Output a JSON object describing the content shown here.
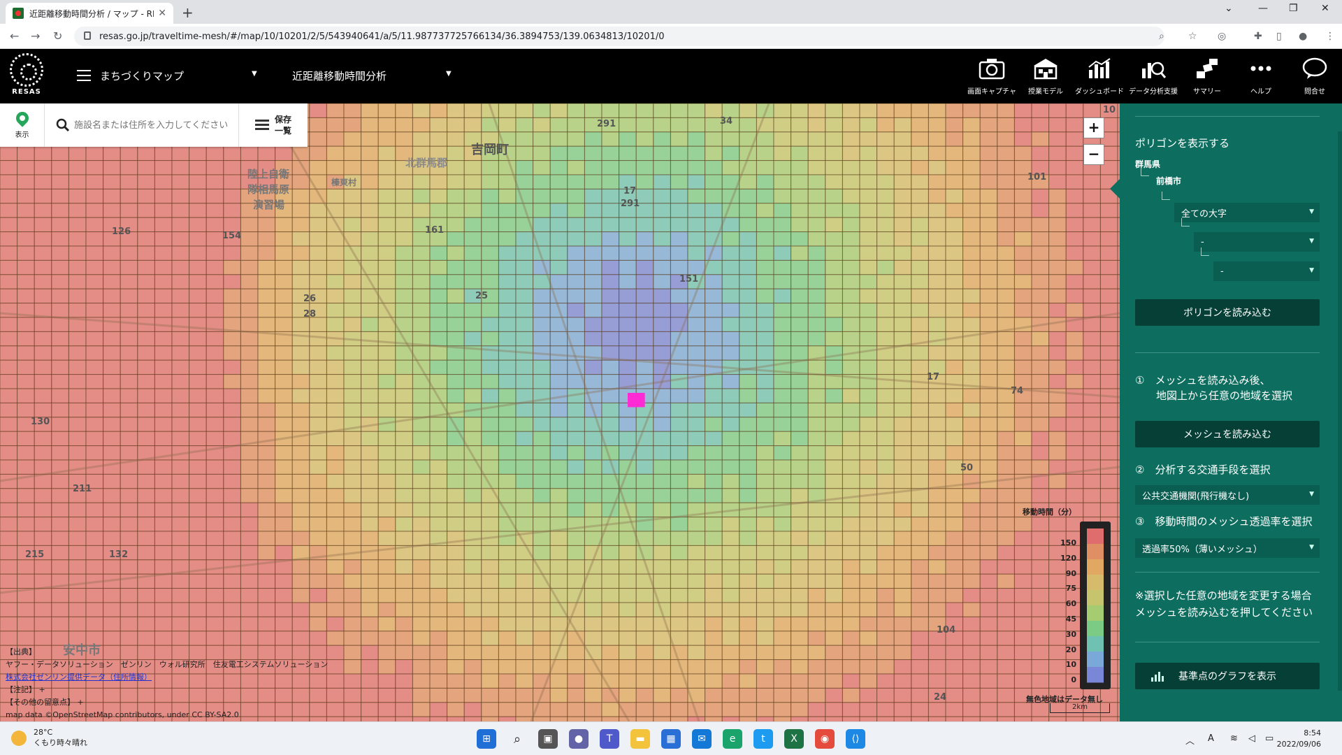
{
  "browser": {
    "tab_title": "近距離移動時間分析 / マップ - RESAS",
    "url": "resas.go.jp/traveltime-mesh/#/map/10/10201/2/5/543940641/a/5/11.987737725766134/36.3894753/139.0634813/10201/0"
  },
  "header": {
    "logo_text": "RESAS",
    "menu_select": "まちづくりマップ",
    "analysis_select": "近距離移動時間分析",
    "buttons": [
      {
        "label": "画面キャプチャ",
        "icon": "camera-icon"
      },
      {
        "label": "授業モデル",
        "icon": "school-icon"
      },
      {
        "label": "ダッシュボード",
        "icon": "dashboard-icon"
      },
      {
        "label": "データ分析支援",
        "icon": "analysis-icon"
      },
      {
        "label": "サマリー",
        "icon": "summary-icon"
      },
      {
        "label": "ヘルプ",
        "icon": "more-icon"
      },
      {
        "label": "問合せ",
        "icon": "chat-icon"
      }
    ]
  },
  "map": {
    "show_label": "表示",
    "search_placeholder": "施設名または住所を入力してください",
    "saved_label_1": "保存",
    "saved_label_2": "一覧",
    "zoom_in": "+",
    "zoom_out": "−",
    "place_labels": [
      "吉岡町",
      "陸上自衛",
      "隊相馬原",
      "演習場",
      "安中市",
      "北群馬郡",
      "榛東村"
    ],
    "route_labels": [
      "291",
      "34",
      "17",
      "291",
      "126",
      "154",
      "161",
      "151",
      "26",
      "28",
      "25",
      "130",
      "211",
      "215",
      "132",
      "101",
      "10",
      "74",
      "50",
      "104",
      "24",
      "17"
    ],
    "legend": {
      "title": "移動時間（分）",
      "ticks": [
        "150",
        "120",
        "90",
        "75",
        "60",
        "45",
        "30",
        "20",
        "10",
        "0"
      ],
      "no_data": "無色地域はデータ無し",
      "scale": "2km",
      "colors": [
        "#e06d6d",
        "#e08e63",
        "#e0a860",
        "#d6bb6a",
        "#c6c46c",
        "#a6cc72",
        "#7ccb85",
        "#6fc1b1",
        "#7aa8d8",
        "#7a86d8"
      ]
    },
    "credits": {
      "line1": "【出典】",
      "line2": "ヤフー・データソリューション　ゼンリン　ウォル研究所　住友電工システムソリューション",
      "line3": "株式会社ゼンリン提供データ（住所情報）",
      "line4": "【注記】 +",
      "line5": "【その他の留意点】 +",
      "line6": "map data ©OpenStreetMap contributors, under CC BY-SA2.0"
    }
  },
  "panel": {
    "polygon_title": "ポリゴンを表示する",
    "pref": "群馬県",
    "city": "前橋市",
    "select_oaza": "全ての大字",
    "select_2": "-",
    "select_3": "-",
    "load_polygon": "ポリゴンを読み込む",
    "step1": "①　メッシュを読み込み後、",
    "step1b": "地図上から任意の地域を選択",
    "load_mesh": "メッシュを読み込む",
    "step2": "②　分析する交通手段を選択",
    "transport": "公共交通機関(飛行機なし)",
    "step3": "③　移動時間のメッシュ透過率を選択",
    "opacity": "透過率50%（薄いメッシュ）",
    "note1": "※選択した任意の地域を変更する場合",
    "note2": "メッシュを読み込むを押してください",
    "graph_btn": "基準点のグラフを表示"
  },
  "taskbar": {
    "temp": "28°C",
    "weather": "くもり時々晴れ",
    "time": "8:54",
    "date": "2022/09/06",
    "ime": "A"
  }
}
